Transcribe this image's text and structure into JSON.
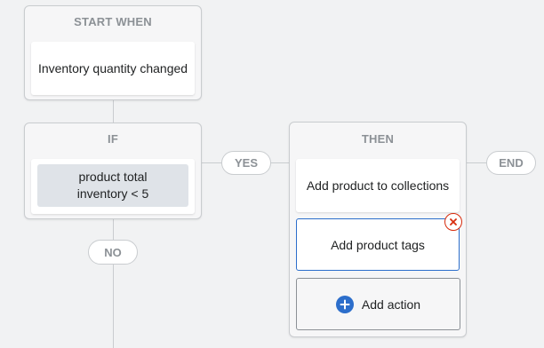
{
  "start": {
    "title": "START WHEN",
    "trigger": "Inventory quantity changed"
  },
  "condition": {
    "title": "IF",
    "line1": "product total",
    "line2": "inventory < 5",
    "yes_label": "YES",
    "no_label": "NO"
  },
  "then": {
    "title": "THEN",
    "actions": [
      {
        "label": "Add product to collections"
      },
      {
        "label": "Add product tags",
        "selected": true
      }
    ],
    "add_action_label": "Add action",
    "end_label": "END"
  },
  "icons": {
    "remove": "close-circle-icon",
    "add": "plus-circle-icon"
  },
  "colors": {
    "accent": "#2c6ecb",
    "danger": "#d72c0d",
    "canvas": "#f1f2f3",
    "muted_text": "#8c9196"
  }
}
